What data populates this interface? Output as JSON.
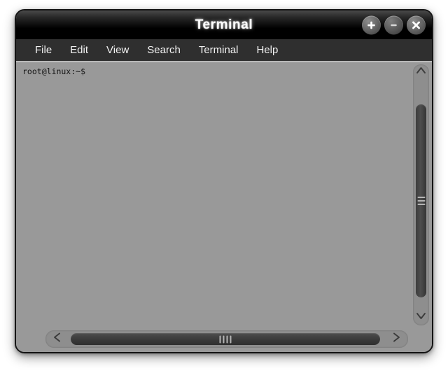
{
  "window": {
    "title": "Terminal",
    "controls": [
      {
        "name": "maximize-button",
        "icon": "plus-icon",
        "label": "+"
      },
      {
        "name": "minimize-button",
        "icon": "minus-icon",
        "label": "−"
      },
      {
        "name": "close-button",
        "icon": "close-icon",
        "label": "×"
      }
    ]
  },
  "menubar": {
    "items": [
      {
        "label": "File"
      },
      {
        "label": "Edit"
      },
      {
        "label": "View"
      },
      {
        "label": "Search"
      },
      {
        "label": "Terminal"
      },
      {
        "label": "Help"
      }
    ]
  },
  "terminal": {
    "lines": [
      "root@linux:~$"
    ],
    "prompt_user": "root",
    "prompt_host": "linux",
    "prompt_path": "~",
    "prompt_symbol": "$"
  },
  "scrollbars": {
    "vertical": {
      "up_arrow_icon": "chevron-up-icon",
      "down_arrow_icon": "chevron-down-icon",
      "grip_lines": 3
    },
    "horizontal": {
      "left_arrow_icon": "chevron-left-icon",
      "right_arrow_icon": "chevron-right-icon",
      "grip_lines": 4
    }
  },
  "colors": {
    "page_background": "#ffffff",
    "titlebar_top": "#4a4a4a",
    "titlebar_bottom": "#000000",
    "menubar_background": "#2f2f2f",
    "menubar_text": "#f2f2f2",
    "terminal_background": "#999999",
    "terminal_text": "#131313",
    "scrollbar_track": "#8e8e8e",
    "scrollbar_thumb": "#3c3c3c",
    "window_border": "#141414"
  }
}
